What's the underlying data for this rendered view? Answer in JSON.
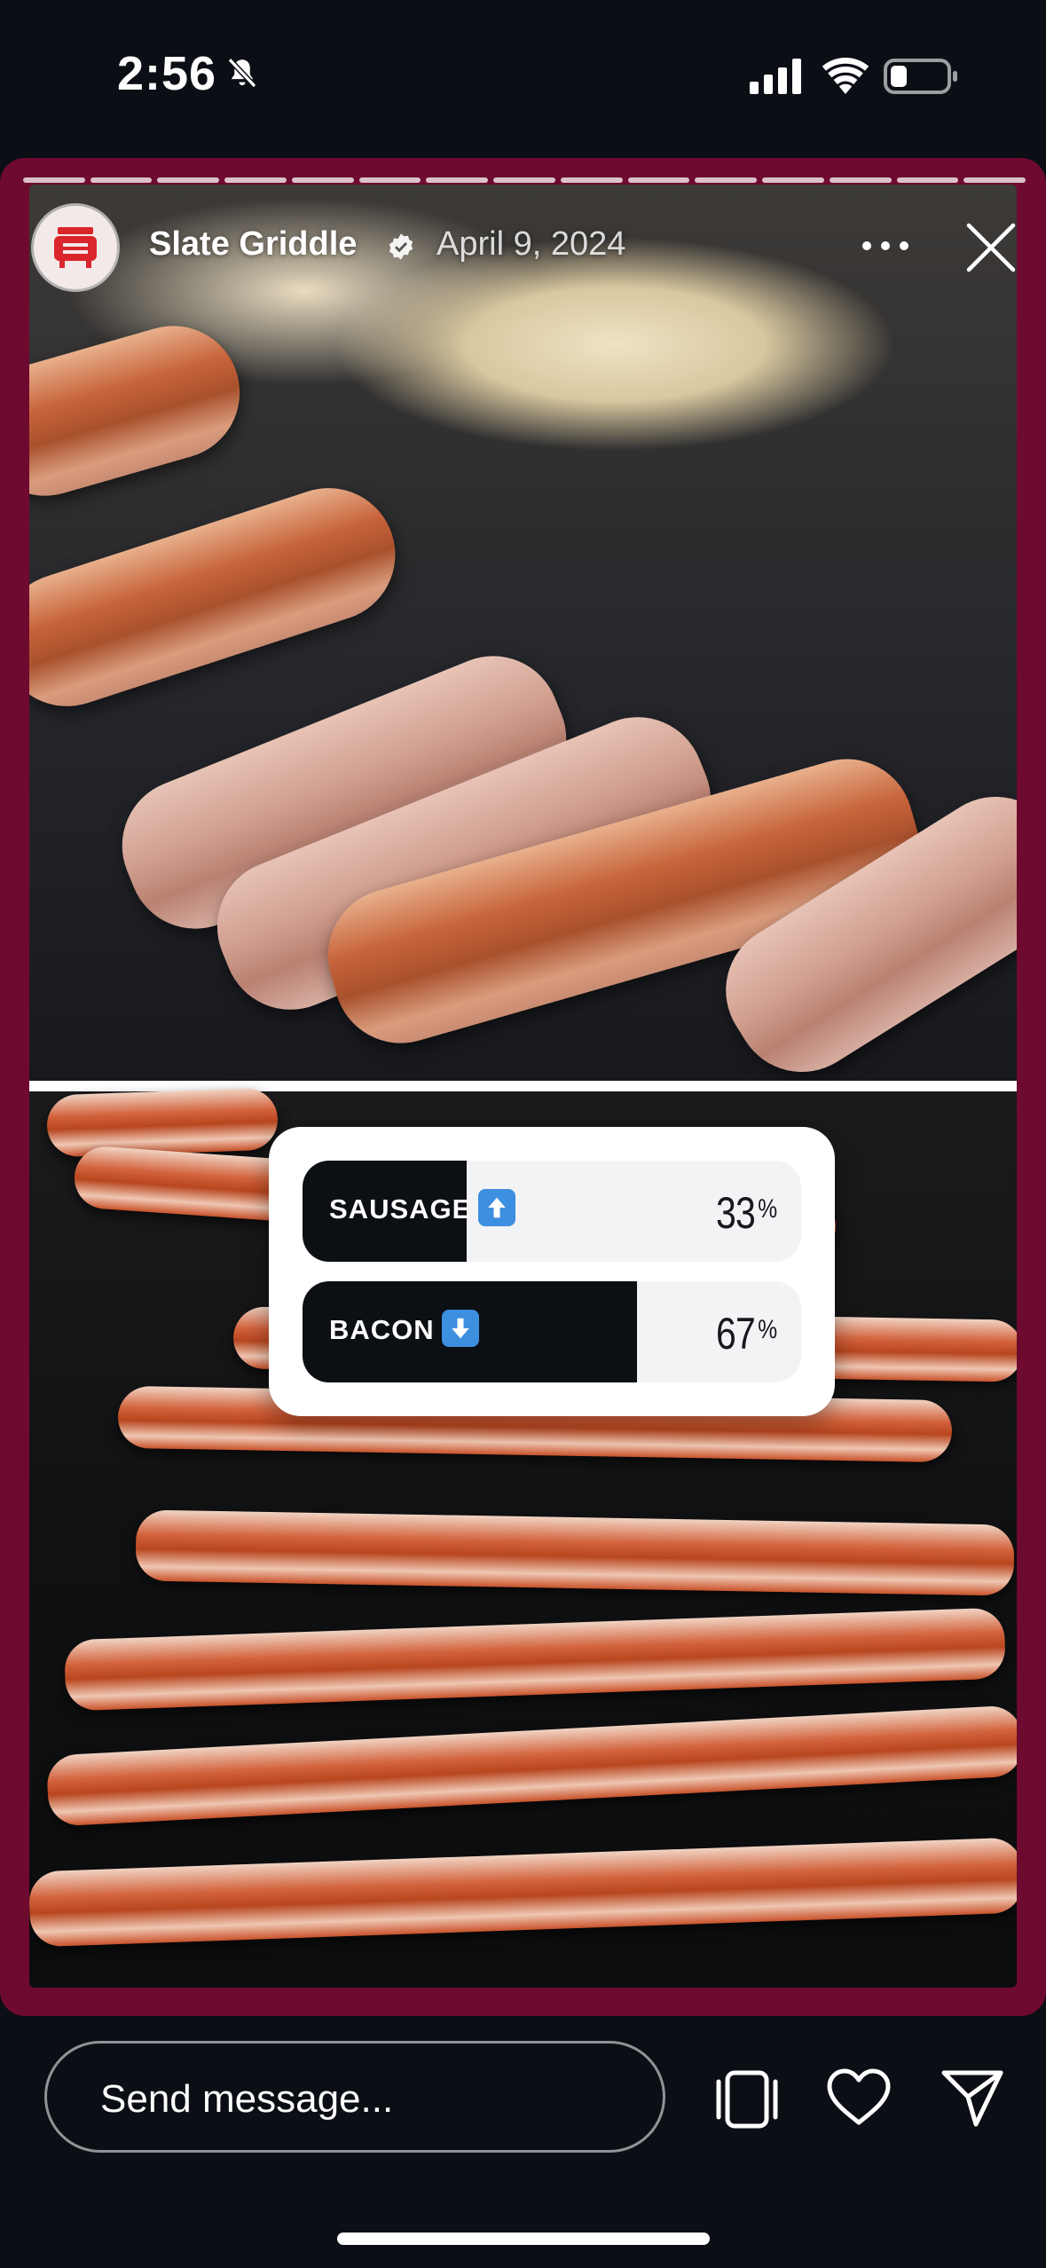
{
  "status_bar": {
    "time": "2:56",
    "icons": [
      "bell-slash-icon",
      "cellular-signal-icon",
      "wifi-icon",
      "battery-icon"
    ]
  },
  "story": {
    "progress_segments": 15,
    "account_name": "Slate Griddle",
    "verified": true,
    "date": "April 9, 2024",
    "frame_color": "#6e0a2f"
  },
  "poll": {
    "options": [
      {
        "label": "SAUSAGE",
        "emoji": "up-arrow-emoji",
        "percent": 33,
        "percent_text": "33"
      },
      {
        "label": "BACON",
        "emoji": "down-arrow-emoji",
        "percent": 67,
        "percent_text": "67"
      }
    ],
    "percent_symbol": "%"
  },
  "bottom_bar": {
    "message_placeholder": "Send message...",
    "icons": [
      "repost-icon",
      "heart-icon",
      "send-icon"
    ]
  }
}
